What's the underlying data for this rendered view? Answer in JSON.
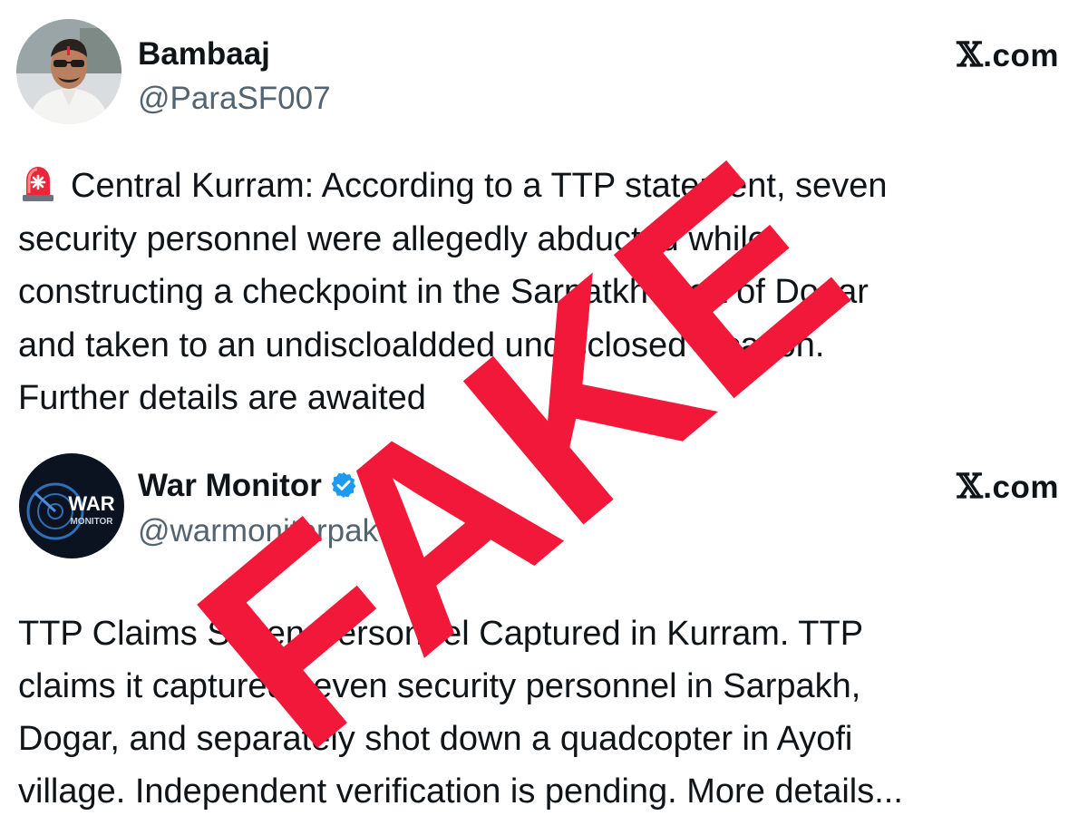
{
  "tweets": [
    {
      "author": {
        "name": "Bambaaj",
        "handle": "@ParaSF007",
        "verified": false
      },
      "source": {
        "logo": "𝕏",
        "domain": ".com"
      },
      "text_prefix_icon": "siren-emoji-icon",
      "text_lines": [
        "Central Kurram: According to a TTP statement, seven",
        "security personnel were allegedly abducted while",
        "constructing a checkpoint in the Sarpatkh area of Dogar",
        "and taken to an undiscloaldded undisclosed location.",
        "Further details are awaited"
      ]
    },
    {
      "author": {
        "name": "War Monitor",
        "handle": "@warmonitorpak",
        "verified": true,
        "avatar_text": [
          "WAR",
          "MONITOR"
        ]
      },
      "source": {
        "logo": "𝕏",
        "domain": ".com"
      },
      "text_lines": [
        "TTP Claims Seven Personnel Captured in Kurram. TTP",
        "claims it captured seven security personnel in Sarpakh,",
        "Dogar, and separately shot down a quadcopter in Ayofi",
        "village. Independent verification is pending. More details..."
      ]
    }
  ],
  "overlay": {
    "stamp_text": "FAKE",
    "stamp_color": "#f2183a"
  },
  "colors": {
    "text": "#0f1419",
    "handle": "#536471",
    "verified_blue": "#1d9bf0",
    "war_monitor_bg": "#0b1220"
  }
}
